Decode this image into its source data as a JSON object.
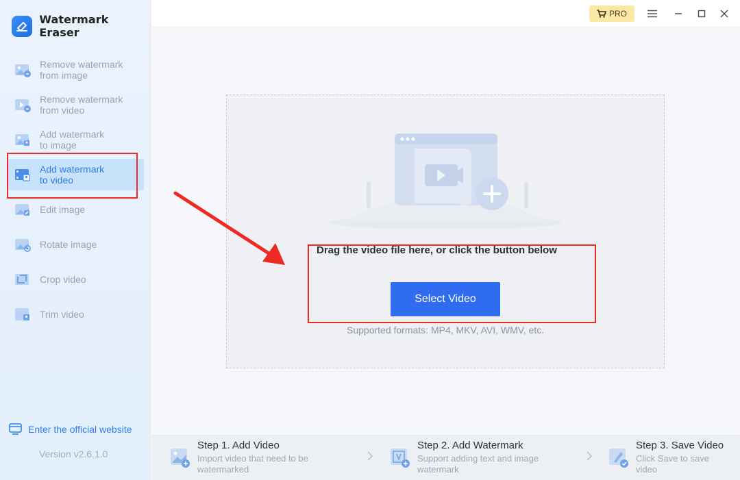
{
  "app": {
    "name": "Watermark Eraser"
  },
  "sidebar": {
    "items": [
      {
        "line1": "Remove watermark",
        "line2": "from image",
        "icon": "remove-watermark-image-icon"
      },
      {
        "line1": "Remove watermark",
        "line2": "from video",
        "icon": "remove-watermark-video-icon"
      },
      {
        "line1": "Add watermark",
        "line2": "to image",
        "icon": "add-watermark-image-icon"
      },
      {
        "line1": "Add watermark",
        "line2": "to video",
        "icon": "add-watermark-video-icon",
        "active": true
      },
      {
        "line1": "Edit image",
        "line2": "",
        "icon": "edit-image-icon"
      },
      {
        "line1": "Rotate image",
        "line2": "",
        "icon": "rotate-image-icon"
      },
      {
        "line1": "Crop video",
        "line2": "",
        "icon": "crop-video-icon"
      },
      {
        "line1": "Trim video",
        "line2": "",
        "icon": "trim-video-icon"
      }
    ],
    "website_link": "Enter the official website",
    "version": "Version v2.6.1.0"
  },
  "topbar": {
    "pro_label": "PRO"
  },
  "main": {
    "drop_text": "Drag the video file here, or click the button below",
    "select_button": "Select Video",
    "formats": "Supported formats: MP4, MKV, AVI, WMV, etc."
  },
  "steps": [
    {
      "title": "Step 1. Add Video",
      "desc1": "Import video that need to be",
      "desc2": "watermarked"
    },
    {
      "title": "Step 2. Add Watermark",
      "desc1": "Support adding text and image",
      "desc2": "watermark"
    },
    {
      "title": "Step 3. Save Video",
      "desc1": "Click Save to save",
      "desc2": "video"
    }
  ],
  "colors": {
    "accent": "#2f6cf0",
    "highlight": "#ee2a24",
    "pro_bg": "#fbe7a6"
  }
}
